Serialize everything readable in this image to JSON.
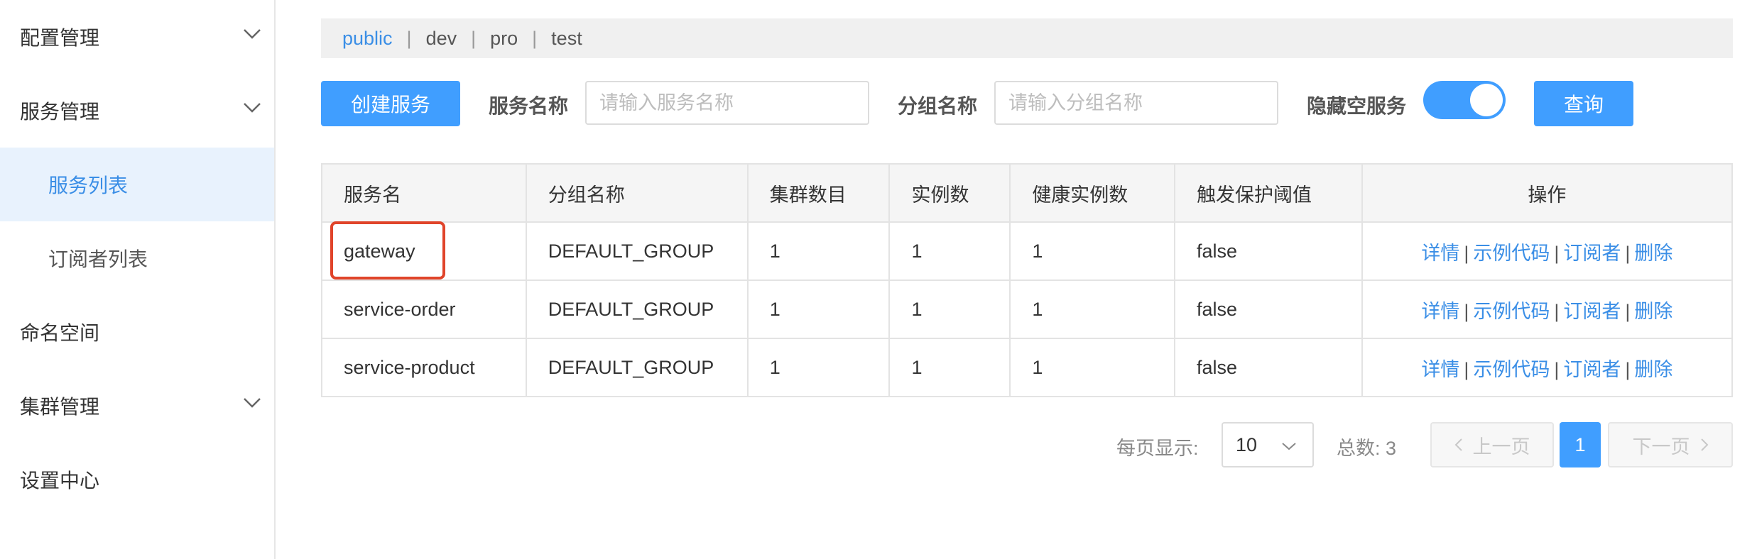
{
  "sidebar": {
    "items": [
      {
        "label": "配置管理",
        "expandable": true
      },
      {
        "label": "服务管理",
        "expandable": true
      },
      {
        "label": "服务列表",
        "sub": true,
        "active": true
      },
      {
        "label": "订阅者列表",
        "sub": true
      },
      {
        "label": "命名空间"
      },
      {
        "label": "集群管理",
        "expandable": true
      },
      {
        "label": "设置中心"
      }
    ]
  },
  "namespaces": {
    "items": [
      "public",
      "dev",
      "pro",
      "test"
    ],
    "active": "public",
    "separator": "|"
  },
  "toolbar": {
    "create_label": "创建服务",
    "service_name_label": "服务名称",
    "service_name_placeholder": "请输入服务名称",
    "group_name_label": "分组名称",
    "group_name_placeholder": "请输入分组名称",
    "hide_empty_label": "隐藏空服务",
    "hide_empty_on": true,
    "query_label": "查询"
  },
  "table": {
    "headers": [
      "服务名",
      "分组名称",
      "集群数目",
      "实例数",
      "健康实例数",
      "触发保护阈值",
      "操作"
    ],
    "rows": [
      {
        "name": "gateway",
        "group": "DEFAULT_GROUP",
        "clusters": "1",
        "instances": "1",
        "healthy": "1",
        "protect": "false"
      },
      {
        "name": "service-order",
        "group": "DEFAULT_GROUP",
        "clusters": "1",
        "instances": "1",
        "healthy": "1",
        "protect": "false"
      },
      {
        "name": "service-product",
        "group": "DEFAULT_GROUP",
        "clusters": "1",
        "instances": "1",
        "healthy": "1",
        "protect": "false"
      }
    ],
    "actions": {
      "detail": "详情",
      "sample": "示例代码",
      "subscribers": "订阅者",
      "delete": "删除",
      "separator": "|"
    }
  },
  "pagination": {
    "per_page_label": "每页显示:",
    "per_page_value": "10",
    "total_label": "总数: 3",
    "prev_label": "上一页",
    "next_label": "下一页",
    "current_page": "1"
  },
  "colors": {
    "accent": "#409eff",
    "highlight": "#e0442a",
    "active_bg": "#e8f2fd"
  }
}
